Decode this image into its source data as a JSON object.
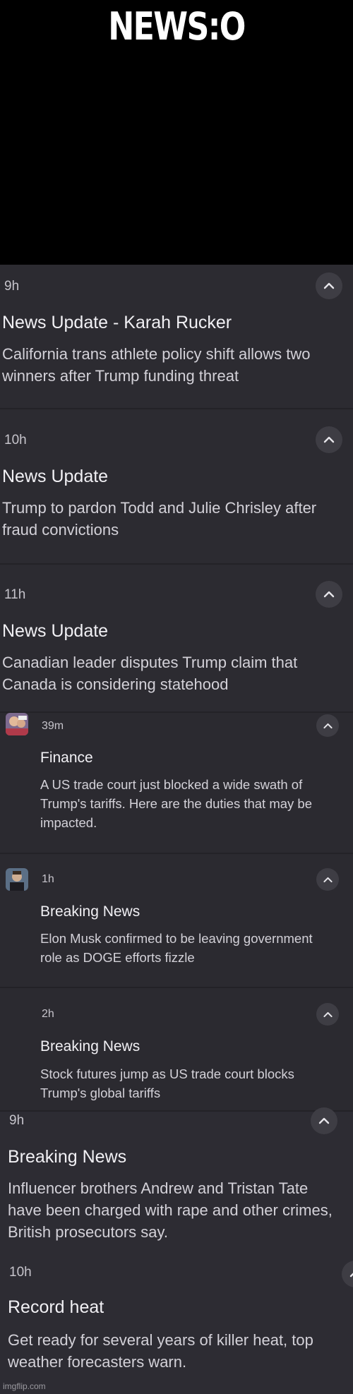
{
  "header": {
    "title": "NEWS:O"
  },
  "notifications": [
    {
      "time": "9h",
      "title": "News Update - Karah Rucker",
      "body": "California trans athlete policy shift allows two winners after Trump funding threat"
    },
    {
      "time": "10h",
      "title": "News Update",
      "body": "Trump to pardon Todd and Julie Chrisley after fraud convictions"
    },
    {
      "time": "11h",
      "title": "News Update",
      "body": "Canadian leader disputes Trump claim that Canada is considering statehood"
    },
    {
      "time": "39m",
      "title": "Finance",
      "body": "A US trade court just blocked a wide swath of Trump's tariffs. Here are the duties that may be impacted."
    },
    {
      "time": "1h",
      "title": "Breaking News",
      "body": "Elon Musk confirmed to be leaving government role as DOGE efforts fizzle"
    },
    {
      "time": "2h",
      "title": "Breaking News",
      "body": "Stock futures jump as US trade court blocks Trump's global tariffs"
    },
    {
      "time": "9h",
      "title": "Breaking News",
      "body": "Influencer brothers Andrew and Tristan Tate have been charged with rape and other crimes, British prosecutors say."
    },
    {
      "time": "10h",
      "title": "Record heat",
      "body": "Get ready for several years of killer heat, top weather forecasters warn."
    }
  ],
  "icons": {
    "collapse": "chevron-up-icon"
  },
  "watermark": "imgflip.com"
}
